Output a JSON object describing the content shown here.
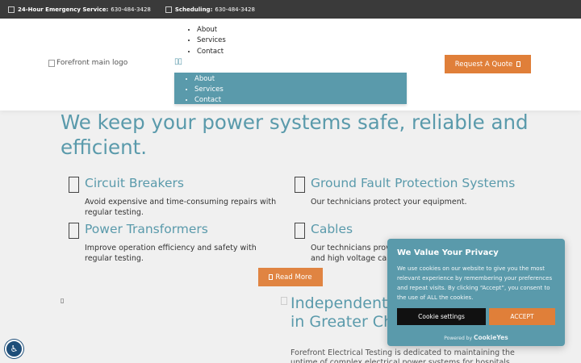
{
  "topbar": {
    "emergency_label": "24-Hour Emergency Service:",
    "emergency_phone": "630-484-3428",
    "scheduling_label": "Scheduling:",
    "scheduling_phone": "630-484-3428"
  },
  "header": {
    "logo_alt": "Forefront main logo",
    "nav": [
      "About",
      "Services",
      "Contact"
    ],
    "dropdown": [
      "About",
      "Services",
      "Contact"
    ],
    "menu_toggle": "",
    "quote_button": "Request A Quote"
  },
  "headline": "We keep your power systems safe, reliable and efficient.",
  "services": [
    {
      "title": "Circuit Breakers",
      "desc": "Avoid expensive and time-consuming repairs with regular testing."
    },
    {
      "title": "Ground Fault Protection Systems",
      "desc": "Our technicians protect your equipment."
    },
    {
      "title": "Power Transformers",
      "desc": "Improve operation efficiency and safety with regular testing."
    },
    {
      "title": "Cables",
      "desc": "Our technicians provi and high voltage cab"
    }
  ],
  "read_more": "Read More",
  "section2": {
    "title_line1": "Independent",
    "title_line2": "in Greater Ch",
    "para": "Forefront Electrical Testing is dedicated to maintaining the uptime of complex electrical power systems for hospitals"
  },
  "cookie": {
    "title": "We Value Your Privacy",
    "text": "We use cookies on our website to give you the most relevant experience by remembering your preferences and repeat visits. By clicking “Accept”, you consent to the use of ALL the cookies.",
    "settings_button": "Cookie settings",
    "accept_button": "ACCEPT",
    "powered_by": "Powered by",
    "brand": "CookieYes"
  },
  "colors": {
    "accent_teal": "#5a9aab",
    "accent_orange": "#e07f39",
    "topbar_bg": "#3a3a3a"
  },
  "icons": {
    "phone": "phone-icon",
    "calendar": "calendar-icon",
    "service": "service-icon",
    "accessibility": "accessibility-icon"
  }
}
